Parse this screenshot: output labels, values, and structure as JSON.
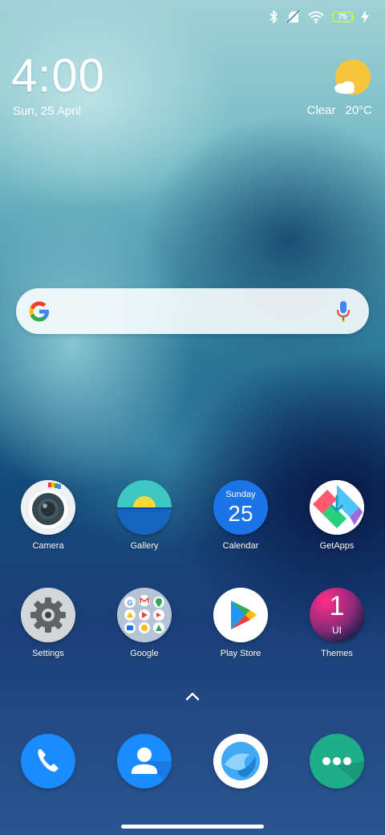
{
  "status_bar": {
    "battery_level": "75",
    "icons": [
      "bluetooth-icon",
      "no-sim-icon",
      "wifi-icon",
      "battery-icon",
      "charging-bolt-icon"
    ]
  },
  "clock": {
    "time": "4:00",
    "date": "Sun, 25 April"
  },
  "weather": {
    "condition": "Clear",
    "temperature": "20°C",
    "icon": "sun-cloud-icon"
  },
  "search": {
    "icons": [
      "google-logo-icon",
      "microphone-icon"
    ]
  },
  "apps": [
    {
      "label": "Camera",
      "icon": "camera-icon"
    },
    {
      "label": "Gallery",
      "icon": "gallery-icon"
    },
    {
      "label": "Calendar",
      "icon": "calendar-icon",
      "weekday": "Sunday",
      "day": "25"
    },
    {
      "label": "GetApps",
      "icon": "getapps-icon"
    },
    {
      "label": "Settings",
      "icon": "settings-gear-icon"
    },
    {
      "label": "Google",
      "icon": "google-folder-icon"
    },
    {
      "label": "Play Store",
      "icon": "play-store-icon"
    },
    {
      "label": "Themes",
      "icon": "themes-icon",
      "badge_top": "1",
      "badge_bottom": "UI"
    }
  ],
  "dock": [
    {
      "name": "Phone",
      "icon": "phone-icon"
    },
    {
      "name": "Contacts",
      "icon": "contacts-icon"
    },
    {
      "name": "Browser",
      "icon": "browser-icon"
    },
    {
      "name": "Messages",
      "icon": "messages-icon"
    }
  ],
  "colors": {
    "accent_blue": "#1a73e8",
    "battery_green": "#b9f35a"
  }
}
